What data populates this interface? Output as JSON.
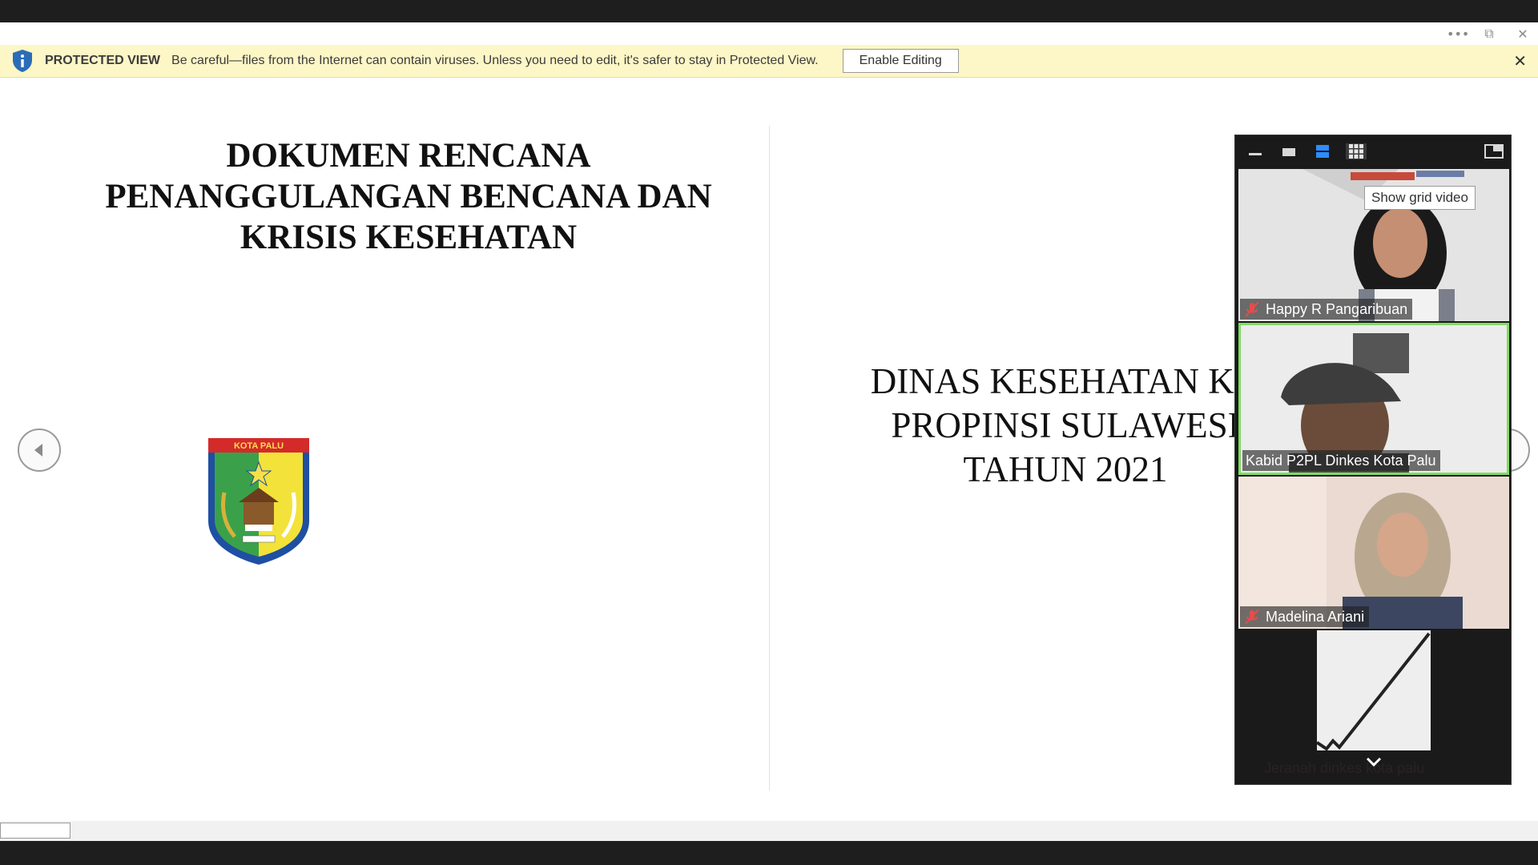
{
  "window": {
    "controls": [
      "more-icon",
      "fullscreen-icon",
      "close-icon"
    ],
    "more_glyph": "•••",
    "restore_glyph": "⧉",
    "close_glyph": "✕"
  },
  "protected_view": {
    "label": "PROTECTED VIEW",
    "message": "Be careful—files from the Internet can contain viruses. Unless you need to edit, it's safer to stay in Protected View.",
    "button": "Enable Editing",
    "close_glyph": "✕",
    "colors": {
      "background": "#fdf6c7",
      "shield": "#2b6cb8"
    }
  },
  "document": {
    "left_page": {
      "title_lines": [
        "DOKUMEN RENCANA",
        "PENANGGULANGAN BENCANA DAN",
        "KRISIS KESEHATAN"
      ],
      "logo": {
        "banner_text": "KOTA PALU",
        "icon": "kota-palu-emblem"
      }
    },
    "right_page": {
      "title_lines": [
        "DINAS KESEHATAN KO",
        "PROPINSI SULAWESI",
        "TAHUN 2021"
      ]
    },
    "nav": {
      "prev_icon": "chevron-left-icon",
      "next_icon": "chevron-right-icon"
    }
  },
  "meeting_panel": {
    "toolbar_icons": [
      "minimize-icon",
      "thumbnail-icon",
      "speaker-view-icon",
      "grid-view-icon",
      "exit-panel-icon"
    ],
    "tooltip": "Show grid video",
    "participants": [
      {
        "name": "Happy R Pangaribuan",
        "muted": true,
        "active": false
      },
      {
        "name": "Kabid P2PL Dinkes  Kota Palu",
        "muted": false,
        "active": true
      },
      {
        "name": "Madelina Ariani",
        "muted": true,
        "active": false
      },
      {
        "name": "Jeranah dinkes kota palu",
        "muted": true,
        "active": false
      }
    ],
    "colors": {
      "active_border": "#7fdc62",
      "selected_icon": "#2d8cff"
    }
  }
}
